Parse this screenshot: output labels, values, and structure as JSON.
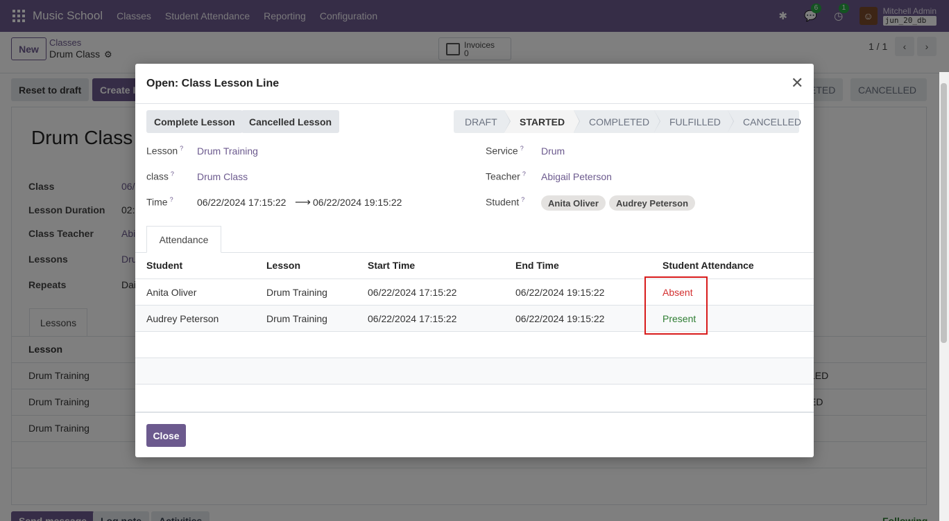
{
  "topbar": {
    "app_name": "Music School",
    "menus": [
      "Classes",
      "Student Attendance",
      "Reporting",
      "Configuration"
    ],
    "chat_badge": "6",
    "activity_badge": "1",
    "user_name": "Mitchell Admin",
    "db_name": "jun_20_db"
  },
  "control_panel": {
    "new_label": "New",
    "breadcrumb_parent": "Classes",
    "breadcrumb_current": "Drum Class",
    "invoices_label": "Invoices",
    "invoices_count": "0",
    "pager": "1 / 1"
  },
  "background_form": {
    "reset_label": "Reset to draft",
    "create_label": "Create I",
    "status_right_1": "ETED",
    "status_right_2": "CANCELLED",
    "title": "Drum Class",
    "fields": [
      {
        "label": "Class",
        "value": "06/"
      },
      {
        "label": "Lesson Duration",
        "value": "02:"
      },
      {
        "label": "Class Teacher",
        "value": "Abi"
      },
      {
        "label": "Lessons",
        "value": "Dru"
      },
      {
        "label": "Repeats",
        "value": "Dai"
      }
    ],
    "tab_label": "Lessons",
    "list_header": "Lesson",
    "rows": [
      {
        "lesson": "Drum Training",
        "status": "LED"
      },
      {
        "lesson": "Drum Training",
        "status": "ED"
      },
      {
        "lesson": "Drum Training",
        "status": "-"
      }
    ],
    "chatter": [
      "Send message",
      "Log note",
      "Activities"
    ],
    "following": "Following"
  },
  "modal": {
    "title": "Open: Class Lesson Line",
    "complete_label": "Complete Lesson",
    "cancelled_label": "Cancelled Lesson",
    "statuses": [
      "DRAFT",
      "STARTED",
      "COMPLETED",
      "FULFILLED",
      "CANCELLED"
    ],
    "current_status": "STARTED",
    "lesson_label": "Lesson",
    "lesson_value": "Drum Training",
    "class_label": "class",
    "class_value": "Drum Class",
    "time_label": "Time",
    "time_start": "06/22/2024 17:15:22",
    "time_end": "06/22/2024 19:15:22",
    "service_label": "Service",
    "service_value": "Drum",
    "teacher_label": "Teacher",
    "teacher_value": "Abigail Peterson",
    "student_label": "Student",
    "students": [
      "Anita Oliver",
      "Audrey Peterson"
    ],
    "tab_label": "Attendance",
    "table": {
      "headers": [
        "Student",
        "Lesson",
        "Start Time",
        "End Time",
        "Student Attendance"
      ],
      "rows": [
        {
          "student": "Anita Oliver",
          "lesson": "Drum Training",
          "start": "06/22/2024 17:15:22",
          "end": "06/22/2024 19:15:22",
          "attendance": "Absent"
        },
        {
          "student": "Audrey Peterson",
          "lesson": "Drum Training",
          "start": "06/22/2024 17:15:22",
          "end": "06/22/2024 19:15:22",
          "attendance": "Present"
        }
      ]
    },
    "close_label": "Close"
  },
  "colors": {
    "brand": "#6c5a8e",
    "absent": "#d32f2f",
    "present": "#2e7d32",
    "highlight": "#d81b1b"
  }
}
